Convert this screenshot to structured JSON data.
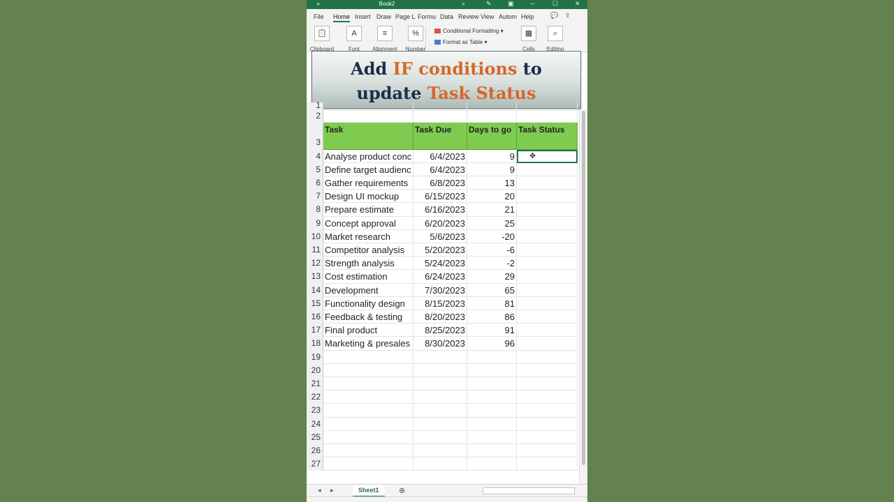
{
  "window": {
    "title": "Book2"
  },
  "menu": [
    "File",
    "Home",
    "Insert",
    "Draw",
    "Page L",
    "Formu",
    "Data",
    "Review",
    "View",
    "Autom",
    "Help"
  ],
  "ribbon": {
    "groups": [
      {
        "label": "Clipboard",
        "icon": "clipboard-icon",
        "glyph": "📋"
      },
      {
        "label": "Font",
        "icon": "font-color-icon",
        "glyph": "A"
      },
      {
        "label": "Alignment",
        "icon": "alignment-icon",
        "glyph": "≡"
      },
      {
        "label": "Number",
        "icon": "percent-icon",
        "glyph": "%"
      },
      {
        "label": "Cells",
        "icon": "cells-icon",
        "glyph": "▦"
      },
      {
        "label": "Editing",
        "icon": "search-icon",
        "glyph": "⌕"
      }
    ],
    "conditional_formatting": "Conditional Formatting",
    "format_as_table": "Format as Table"
  },
  "banner": {
    "line1_a": "Add ",
    "line1_b": "IF conditions",
    "line1_c": " to",
    "line2_a": "update ",
    "line2_b": "Task Status"
  },
  "sheet": {
    "headers": [
      "Task",
      "Task Due",
      "Days to go",
      "Task Status"
    ],
    "rows": [
      [
        "Analyse product conc",
        "6/4/2023",
        "9",
        ""
      ],
      [
        "Define target audienc",
        "6/4/2023",
        "9",
        ""
      ],
      [
        "Gather requirements",
        "6/8/2023",
        "13",
        ""
      ],
      [
        "Design UI mockup",
        "6/15/2023",
        "20",
        ""
      ],
      [
        "Prepare estimate",
        "6/16/2023",
        "21",
        ""
      ],
      [
        "Concept approval",
        "6/20/2023",
        "25",
        ""
      ],
      [
        "Market research",
        "5/6/2023",
        "-20",
        ""
      ],
      [
        "Competitor analysis",
        "5/20/2023",
        "-6",
        ""
      ],
      [
        "Strength analysis",
        "5/24/2023",
        "-2",
        ""
      ],
      [
        "Cost estimation",
        "6/24/2023",
        "29",
        ""
      ],
      [
        "Development",
        "7/30/2023",
        "65",
        ""
      ],
      [
        "Functionality design",
        "8/15/2023",
        "81",
        ""
      ],
      [
        "Feedback & testing",
        "8/20/2023",
        "86",
        ""
      ],
      [
        "Final product",
        "8/25/2023",
        "91",
        ""
      ],
      [
        "Marketing & presales",
        "8/30/2023",
        "96",
        ""
      ]
    ],
    "tab": "Sheet1"
  },
  "colors": {
    "excel_green": "#217346",
    "header_fill": "#7ecb50",
    "banner_highlight": "#d4682a",
    "banner_text": "#1e2c4b"
  }
}
